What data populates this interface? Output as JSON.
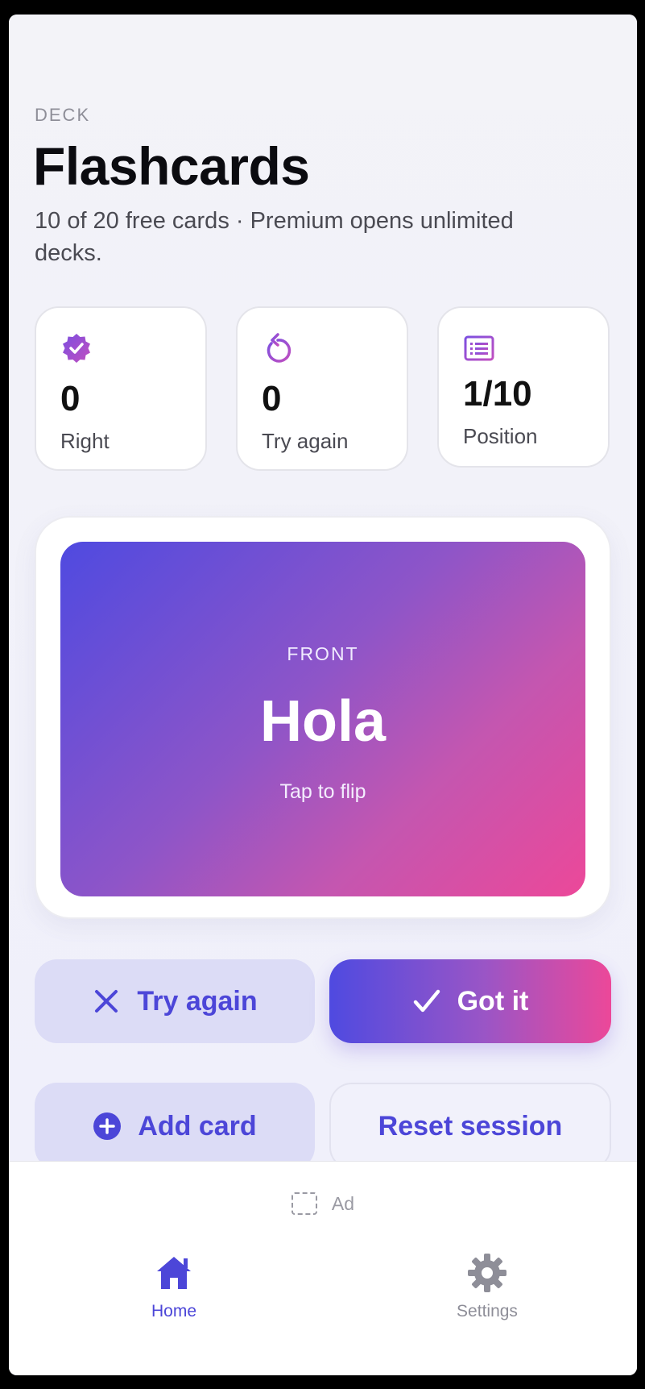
{
  "header": {
    "eyebrow": "DECK",
    "title": "Flashcards",
    "subtitle": "10 of 20 free cards · Premium opens unlimited decks."
  },
  "stats": [
    {
      "value": "0",
      "label": "Right",
      "icon": "verified-badge-icon"
    },
    {
      "value": "0",
      "label": "Try again",
      "icon": "retry-icon"
    },
    {
      "value": "1/10",
      "label": "Position",
      "icon": "list-icon"
    }
  ],
  "card": {
    "side_label": "FRONT",
    "word": "Hola",
    "hint": "Tap to flip"
  },
  "actions": {
    "try_again": "Try again",
    "got_it": "Got it",
    "add_card": "Add card",
    "reset_session": "Reset session"
  },
  "ad": {
    "label": "Ad"
  },
  "tabbar": {
    "home": "Home",
    "settings": "Settings",
    "active": "home"
  },
  "colors": {
    "accent": "#4c46d8",
    "gradient_start": "#4f4ae0",
    "gradient_end": "#ec4899"
  }
}
